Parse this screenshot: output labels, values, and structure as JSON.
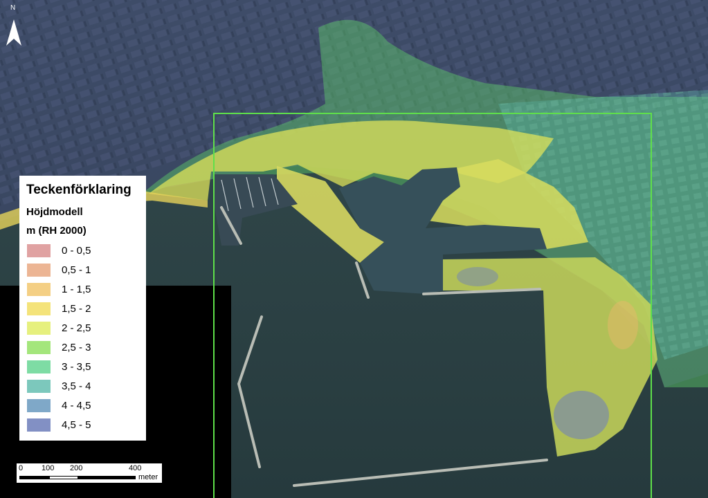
{
  "north_arrow": {
    "label": "N"
  },
  "legend": {
    "title": "Teckenförklaring",
    "subtitle_line1": "Höjdmodell",
    "subtitle_line2": "m (RH 2000)",
    "items": [
      {
        "label": "0 - 0,5",
        "color": "#e0a2a2"
      },
      {
        "label": "0,5 - 1",
        "color": "#ecb594"
      },
      {
        "label": "1 - 1,5",
        "color": "#f4cf84"
      },
      {
        "label": "1,5 - 2",
        "color": "#f4e37a"
      },
      {
        "label": "2 - 2,5",
        "color": "#e6f07e"
      },
      {
        "label": "2,5 - 3",
        "color": "#a4e67c"
      },
      {
        "label": "3 - 3,5",
        "color": "#7edca4"
      },
      {
        "label": "3,5 - 4",
        "color": "#7cc8bc"
      },
      {
        "label": "4 - 4,5",
        "color": "#7fa8c8"
      },
      {
        "label": "4,5 - 5",
        "color": "#8290c4"
      }
    ]
  },
  "scale_bar": {
    "ticks": [
      "0",
      "100",
      "200",
      "400"
    ],
    "unit": "meter"
  },
  "colors": {
    "water": "#2f4548",
    "city": "#3b4a66",
    "boundary": "#5fe04a"
  }
}
